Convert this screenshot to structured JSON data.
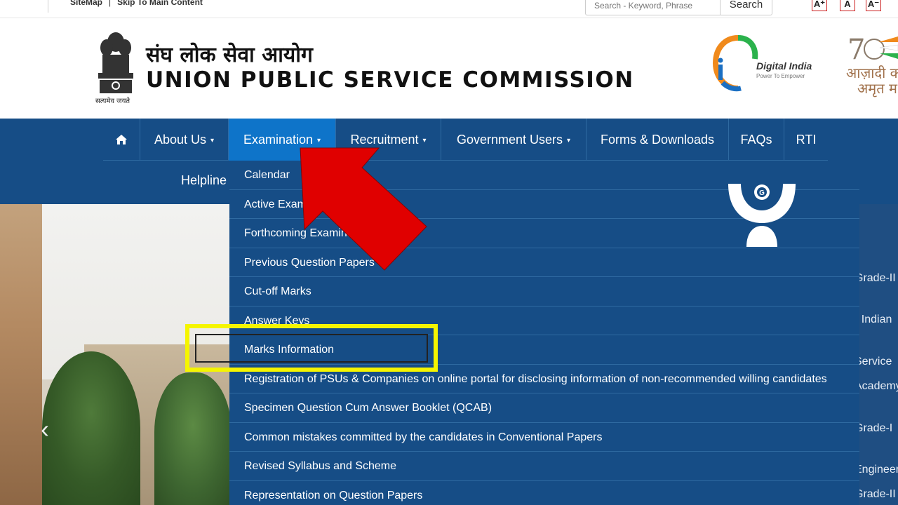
{
  "topbar": {
    "sitemap": "SiteMap",
    "separator": "|",
    "skip": "Skip To Main Content",
    "search_placeholder": "Search - Keyword, Phrase",
    "search_button": "Search",
    "font_increase": "A⁺",
    "font_normal": "A",
    "font_decrease": "A⁻"
  },
  "header": {
    "title_hindi": "संघ लोक सेवा आयोग",
    "title_english": "UNION PUBLIC SERVICE COMMISSION",
    "emblem_caption": "सत्यमेव जयते",
    "digital_india": "Digital India",
    "digital_india_tagline": "Power To Empower",
    "azadi_line1": "आज़ादी का",
    "azadi_line2": "अमृत म"
  },
  "nav": {
    "home_icon": "home-icon",
    "items": [
      {
        "label": "About Us",
        "caret": "▾"
      },
      {
        "label": "Examination",
        "caret": "▾"
      },
      {
        "label": "Recruitment",
        "caret": "▾"
      },
      {
        "label": "Government Users",
        "caret": "▾"
      },
      {
        "label": "Forms & Downloads"
      },
      {
        "label": "FAQs"
      },
      {
        "label": "RTI"
      }
    ],
    "helpline": "Helpline"
  },
  "dropdown": {
    "items": [
      "Calendar",
      "Active Examinations",
      "Forthcoming Examinations",
      "Previous Question Papers",
      "Cut-off Marks",
      "Answer Keys",
      "Marks Information",
      "Registration of PSUs & Companies on online portal for disclosing information of non-recommended willing candidates",
      "Specimen Question Cum Answer Booklet (QCAB)",
      "Common mistakes committed by the candidates in Conventional Papers",
      "Revised Syllabus and Scheme",
      "Representation on Question Papers"
    ]
  },
  "hero": {
    "right_texts": [
      "Grade-II",
      "- Indian",
      "Service",
      "Academy",
      "Grade-I",
      "Engineer",
      "Grade-II"
    ],
    "prev_arrow": "‹"
  },
  "annotations": {
    "arrow_color": "#e00000",
    "highlight_color": "#f5f500"
  }
}
